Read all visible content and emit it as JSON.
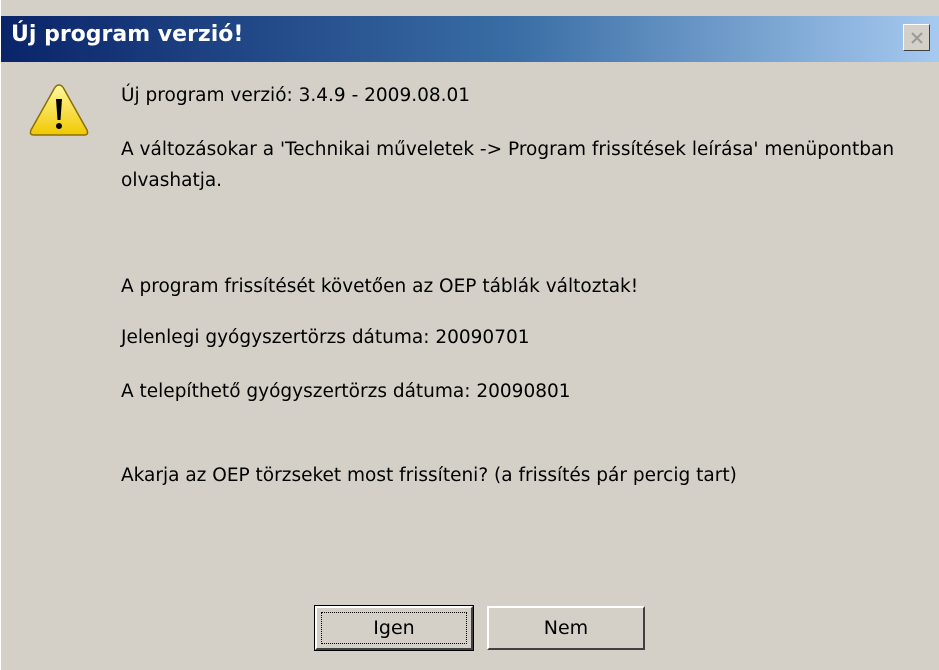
{
  "window": {
    "title": "Új program verzió!",
    "close_glyph": "×"
  },
  "icon": "warning-icon",
  "messages": {
    "version_line": "Új program verzió: 3.4.9 - 2009.08.01",
    "changes_line": "A változásokar a 'Technikai műveletek -> Program frissítések leírása' menüpontban olvashatja.",
    "oep_changed": "A program frissítését követően az OEP táblák változtak!",
    "current_date": "Jelenlegi gyógyszertörzs dátuma: 20090701",
    "installable_date": "A telepíthető gyógyszertörzs dátuma: 20090801",
    "question": "Akarja az OEP törzseket most frissíteni? (a frissítés pár percig tart)"
  },
  "buttons": {
    "yes_label": "Igen",
    "no_label": "Nem"
  },
  "colors": {
    "dialog_bg": "#d4d0c8",
    "title_start": "#0a246a",
    "title_end": "#a6caf0",
    "warning_yellow": "#ffd800"
  }
}
